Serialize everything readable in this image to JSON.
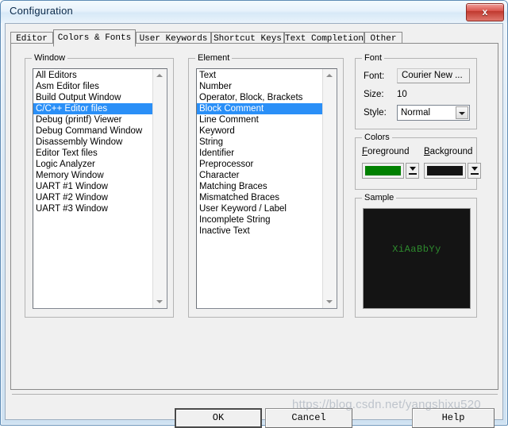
{
  "window": {
    "title": "Configuration",
    "close_label": "x"
  },
  "tabs": [
    {
      "label": "Editor",
      "active": false
    },
    {
      "label": "Colors & Fonts",
      "active": true
    },
    {
      "label": "User Keywords",
      "active": false
    },
    {
      "label": "Shortcut Keys",
      "active": false
    },
    {
      "label": "Text Completion",
      "active": false
    },
    {
      "label": "Other",
      "active": false
    }
  ],
  "window_group": {
    "legend": "Window",
    "items": [
      "All Editors",
      "Asm Editor files",
      "Build Output Window",
      "C/C++ Editor files",
      "Debug (printf) Viewer",
      "Debug Command Window",
      "Disassembly Window",
      "Editor Text files",
      "Logic Analyzer",
      "Memory Window",
      "UART #1 Window",
      "UART #2 Window",
      "UART #3 Window"
    ],
    "selected_index": 3
  },
  "element_group": {
    "legend": "Element",
    "items": [
      "Text",
      "Number",
      "Operator, Block, Brackets",
      "Block Comment",
      "Line Comment",
      "Keyword",
      "String",
      "Identifier",
      "Preprocessor",
      "Character",
      "Matching Braces",
      "Mismatched Braces",
      "User Keyword / Label",
      "Incomplete String",
      "Inactive Text"
    ],
    "selected_index": 3
  },
  "font_group": {
    "legend": "Font",
    "font_label": "Font:",
    "font_value": "Courier New ...",
    "size_label": "Size:",
    "size_value": "10",
    "style_label": "Style:",
    "style_value": "Normal"
  },
  "colors_group": {
    "legend": "Colors",
    "foreground_label": "Foreground",
    "background_label": "Background",
    "foreground_color": "#008000",
    "background_color": "#141414"
  },
  "sample_group": {
    "legend": "Sample",
    "text": "XiAaBbYy",
    "text_color": "#2e8b2e",
    "bg_color": "#141414"
  },
  "buttons": {
    "ok": "OK",
    "cancel": "Cancel",
    "help": "Help"
  },
  "watermark": "https://blog.csdn.net/yangshixu520"
}
